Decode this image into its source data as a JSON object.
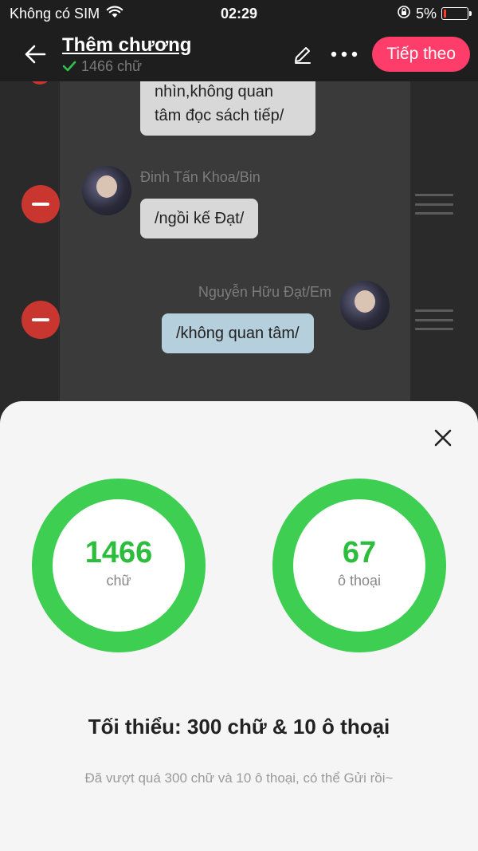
{
  "status_bar": {
    "carrier": "Không có SIM",
    "time": "02:29",
    "battery": "5%",
    "icons": [
      "wifi-icon",
      "orientation-lock-icon",
      "battery-icon"
    ]
  },
  "header": {
    "title": "Thêm chương",
    "word_count": "1466 chữ",
    "next_label": "Tiếp theo",
    "icons": [
      "back-arrow-icon",
      "check-icon",
      "edit-icon",
      "more-icon"
    ]
  },
  "chat": {
    "messages": [
      {
        "sender": "",
        "text_lines": [
          "nhìn,không quan",
          "tâm đọc sách tiếp/"
        ]
      },
      {
        "sender": "Đinh Tấn Khoa/Bin",
        "text_lines": [
          "/ngồi kế Đạt/"
        ]
      },
      {
        "sender": "Nguyễn Hữu Đạt/Em",
        "text_lines": [
          "/không quan tâm/"
        ]
      }
    ]
  },
  "stats": {
    "words": {
      "value": "1466",
      "label": "chữ"
    },
    "dialogs": {
      "value": "67",
      "label": "ô thoại"
    },
    "minimum": "Tối thiểu: 300 chữ & 10 ô thoại",
    "hint": "Đã vượt quá 300 chữ và 10 ô thoại, có thể Gửi rồi~"
  },
  "colors": {
    "accent": "#ff3d6b",
    "ring": "#3ecf52",
    "stat_text": "#2bbd3b",
    "remove": "#c8362f",
    "blue_bubble": "#b5cfdc",
    "gray_bubble": "#d8d8d8"
  }
}
